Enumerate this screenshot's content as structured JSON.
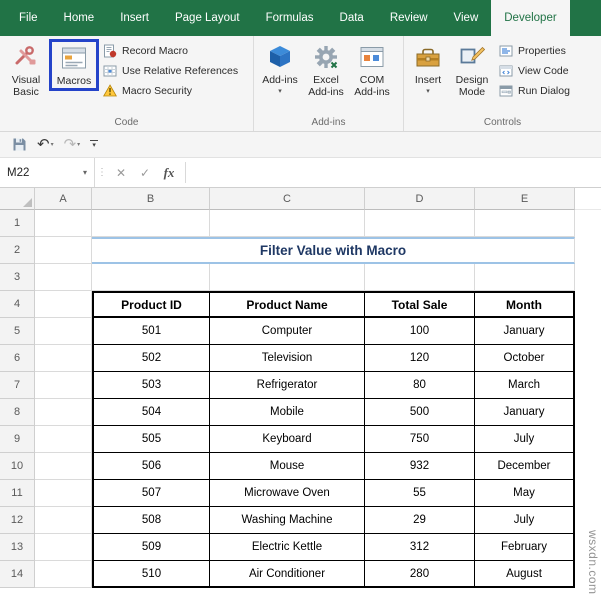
{
  "ribbon_tabs": [
    {
      "label": "File"
    },
    {
      "label": "Home"
    },
    {
      "label": "Insert"
    },
    {
      "label": "Page Layout"
    },
    {
      "label": "Formulas"
    },
    {
      "label": "Data"
    },
    {
      "label": "Review"
    },
    {
      "label": "View"
    },
    {
      "label": "Developer"
    }
  ],
  "ribbon": {
    "code_group": {
      "label": "Code",
      "visual_basic": "Visual Basic",
      "macros": "Macros",
      "record_macro": "Record Macro",
      "use_relative_references": "Use Relative References",
      "macro_security": "Macro Security"
    },
    "addins_group": {
      "label": "Add-ins",
      "add_ins": "Add-ins",
      "excel_add_ins": "Excel Add-ins",
      "com_add_ins": "COM Add-ins"
    },
    "controls_group": {
      "label": "Controls",
      "insert": "Insert",
      "design_mode": "Design Mode",
      "properties": "Properties",
      "view_code": "View Code",
      "run_dialog": "Run Dialog"
    }
  },
  "icons": {
    "dropdown": "▾",
    "undo": "↶",
    "redo": "↷",
    "cancel": "✕",
    "enter": "✓"
  },
  "formula_bar": {
    "name_box": "M22",
    "fx_label": "fx",
    "value": ""
  },
  "sheet": {
    "column_headers": [
      "A",
      "B",
      "C",
      "D",
      "E"
    ],
    "row_numbers": [
      "1",
      "2",
      "3",
      "4",
      "5",
      "6",
      "7",
      "8",
      "9",
      "10",
      "11",
      "12",
      "13",
      "14"
    ],
    "title": "Filter Value with Macro",
    "table": {
      "headers": [
        "Product ID",
        "Product Name",
        "Total Sale",
        "Month"
      ],
      "rows": [
        [
          "501",
          "Computer",
          "100",
          "January"
        ],
        [
          "502",
          "Television",
          "120",
          "October"
        ],
        [
          "503",
          "Refrigerator",
          "80",
          "March"
        ],
        [
          "504",
          "Mobile",
          "500",
          "January"
        ],
        [
          "505",
          "Keyboard",
          "750",
          "July"
        ],
        [
          "506",
          "Mouse",
          "932",
          "December"
        ],
        [
          "507",
          "Microwave Oven",
          "55",
          "May"
        ],
        [
          "508",
          "Washing Machine",
          "29",
          "July"
        ],
        [
          "509",
          "Electric Kettle",
          "312",
          "February"
        ],
        [
          "510",
          "Air Conditioner",
          "280",
          "August"
        ]
      ]
    }
  },
  "watermark": "wsxdn.com",
  "colors": {
    "excel_green": "#217346",
    "title_text": "#1F3864",
    "title_border": "#9DC3E6",
    "highlight_blue": "#2443C9"
  }
}
